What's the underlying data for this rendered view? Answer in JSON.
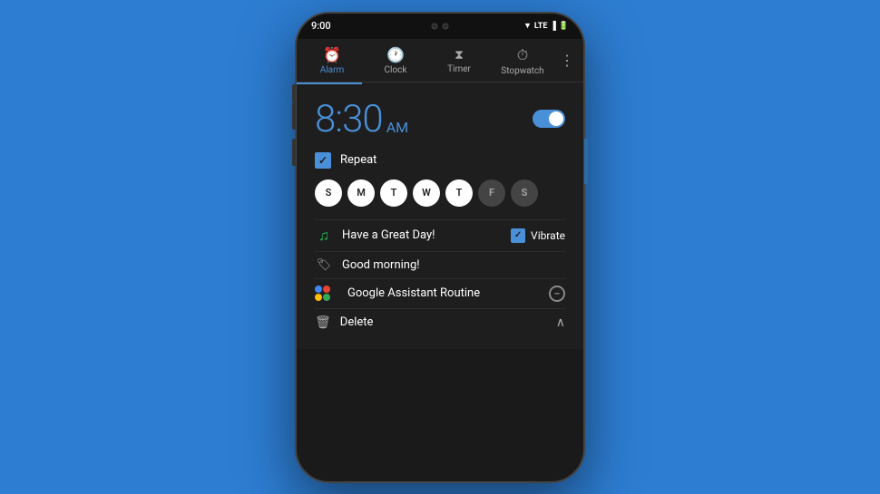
{
  "background_color": "#2d7dd2",
  "phone": {
    "status_bar": {
      "time": "9:00",
      "signal": "LTE",
      "battery": "▮"
    },
    "tabs": [
      {
        "id": "alarm",
        "label": "Alarm",
        "icon": "⏰",
        "active": true
      },
      {
        "id": "clock",
        "label": "Clock",
        "icon": "⏱",
        "active": false
      },
      {
        "id": "timer",
        "label": "Timer",
        "icon": "⏳",
        "active": false
      },
      {
        "id": "stopwatch",
        "label": "Stopwatch",
        "icon": "⏱",
        "active": false
      }
    ],
    "alarm": {
      "time": "8:30",
      "period": "AM",
      "toggle_on": true,
      "repeat": {
        "checked": true,
        "label": "Repeat"
      },
      "days": [
        {
          "letter": "S",
          "active": true
        },
        {
          "letter": "M",
          "active": true
        },
        {
          "letter": "T",
          "active": true
        },
        {
          "letter": "W",
          "active": true
        },
        {
          "letter": "T",
          "active": true
        },
        {
          "letter": "F",
          "active": false
        },
        {
          "letter": "S",
          "active": false
        }
      ],
      "sound_label": "Have a Great Day!",
      "vibrate": {
        "checked": true,
        "label": "Vibrate"
      },
      "label_text": "Good morning!",
      "assistant_label": "Google Assistant Routine",
      "delete_label": "Delete"
    }
  }
}
